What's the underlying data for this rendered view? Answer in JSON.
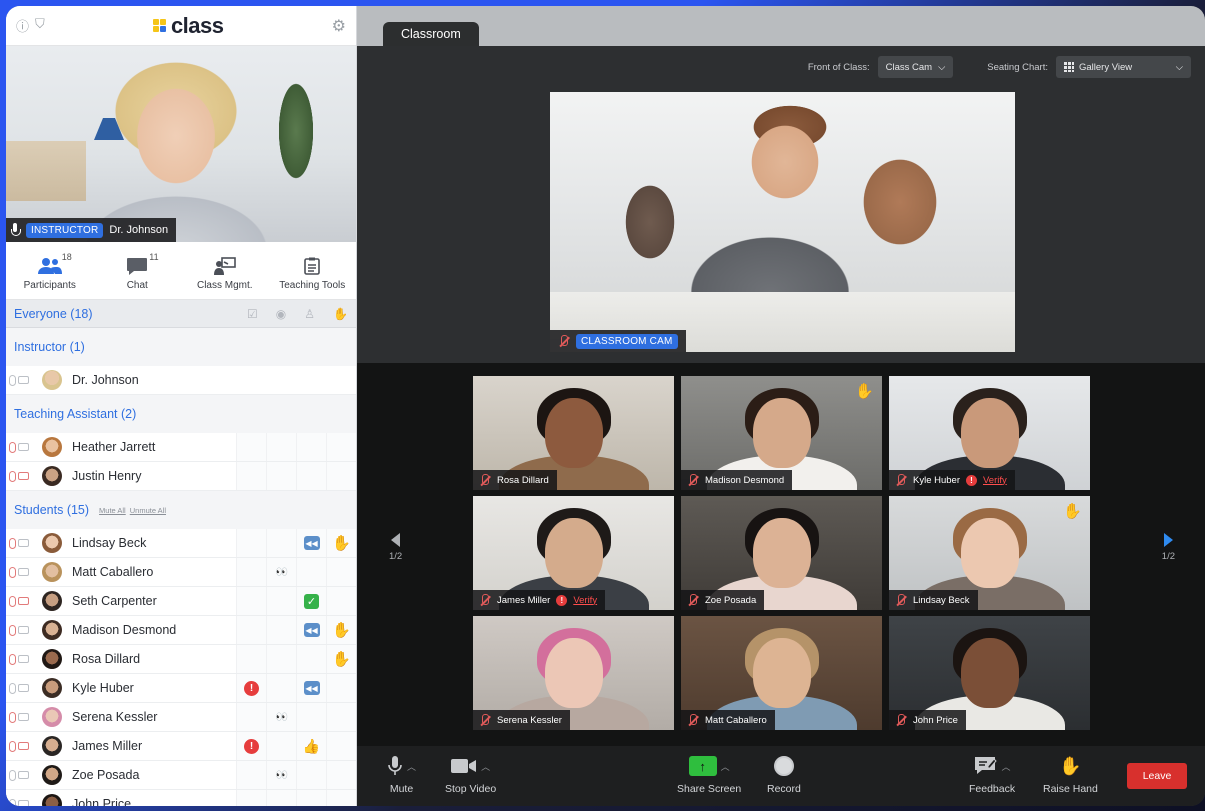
{
  "app": {
    "logo_text": "class",
    "colors": {
      "accent": "#2f6fe0",
      "logo_yellow": "#f5c518",
      "logo_blue": "#2f6fe0",
      "leave_red": "#d8302d",
      "share_green": "#2fbe3e"
    }
  },
  "instructor_video": {
    "role_badge": "INSTRUCTOR",
    "name": "Dr. Johnson"
  },
  "panel_tabs": [
    {
      "label": "Participants",
      "count": "18",
      "icon": "participants-icon"
    },
    {
      "label": "Chat",
      "count": "11",
      "icon": "chat-icon"
    },
    {
      "label": "Class Mgmt.",
      "count": "",
      "icon": "class-mgmt-icon"
    },
    {
      "label": "Teaching Tools",
      "count": "",
      "icon": "teaching-tools-icon"
    }
  ],
  "everyone": {
    "label": "Everyone (18)"
  },
  "groups": {
    "instructor": {
      "label": "Instructor (1)"
    },
    "ta": {
      "label": "Teaching Assistant (2)"
    },
    "students": {
      "label": "Students (15)",
      "mute_all": "Mute All",
      "unmute_all": "Unmute All"
    }
  },
  "instructor_rows": [
    {
      "name": "Dr. Johnson"
    }
  ],
  "ta_rows": [
    {
      "name": "Heather Jarrett"
    },
    {
      "name": "Justin Henry"
    }
  ],
  "student_rows": [
    {
      "name": "Lindsay Beck",
      "c1": "",
      "c2": "",
      "c3": "rewind",
      "c4": "hand"
    },
    {
      "name": "Matt Caballero",
      "c1": "",
      "c2": "eyes",
      "c3": "",
      "c4": ""
    },
    {
      "name": "Seth Carpenter",
      "c1": "",
      "c2": "",
      "c3": "check",
      "c4": ""
    },
    {
      "name": "Madison Desmond",
      "c1": "",
      "c2": "",
      "c3": "rewind",
      "c4": "hand"
    },
    {
      "name": "Rosa Dillard",
      "c1": "",
      "c2": "",
      "c3": "",
      "c4": "hand"
    },
    {
      "name": "Kyle Huber",
      "c1": "alert",
      "c2": "",
      "c3": "rewind",
      "c4": ""
    },
    {
      "name": "Serena Kessler",
      "c1": "",
      "c2": "eyes",
      "c3": "",
      "c4": ""
    },
    {
      "name": "James Miller",
      "c1": "alert",
      "c2": "",
      "c3": "thumb",
      "c4": ""
    },
    {
      "name": "Zoe Posada",
      "c1": "",
      "c2": "eyes",
      "c3": "",
      "c4": ""
    },
    {
      "name": "John Price",
      "c1": "",
      "c2": "",
      "c3": "",
      "c4": ""
    }
  ],
  "room_tab": "Classroom",
  "stage": {
    "front_label": "Front of Class:",
    "front_value": "Class Cam",
    "seating_label": "Seating Chart:",
    "seating_value": "Gallery View",
    "cam_badge": "CLASSROOM CAM"
  },
  "gallery": {
    "page_left": "1/2",
    "page_right": "1/2",
    "verify_label": "Verify",
    "tiles": [
      {
        "name": "Rosa Dillard",
        "hand": false,
        "verify": false
      },
      {
        "name": "Madison Desmond",
        "hand": true,
        "verify": false
      },
      {
        "name": "Kyle Huber",
        "hand": false,
        "verify": true
      },
      {
        "name": "James Miller",
        "hand": false,
        "verify": true
      },
      {
        "name": "Zoe Posada",
        "hand": false,
        "verify": false
      },
      {
        "name": "Lindsay Beck",
        "hand": true,
        "verify": false
      },
      {
        "name": "Serena Kessler",
        "hand": false,
        "verify": false
      },
      {
        "name": "Matt Caballero",
        "hand": false,
        "verify": false
      },
      {
        "name": "John Price",
        "hand": false,
        "verify": false
      }
    ]
  },
  "toolbar": {
    "mute": "Mute",
    "stop_video": "Stop Video",
    "share_screen": "Share Screen",
    "record": "Record",
    "feedback": "Feedback",
    "raise_hand": "Raise Hand",
    "leave": "Leave"
  }
}
